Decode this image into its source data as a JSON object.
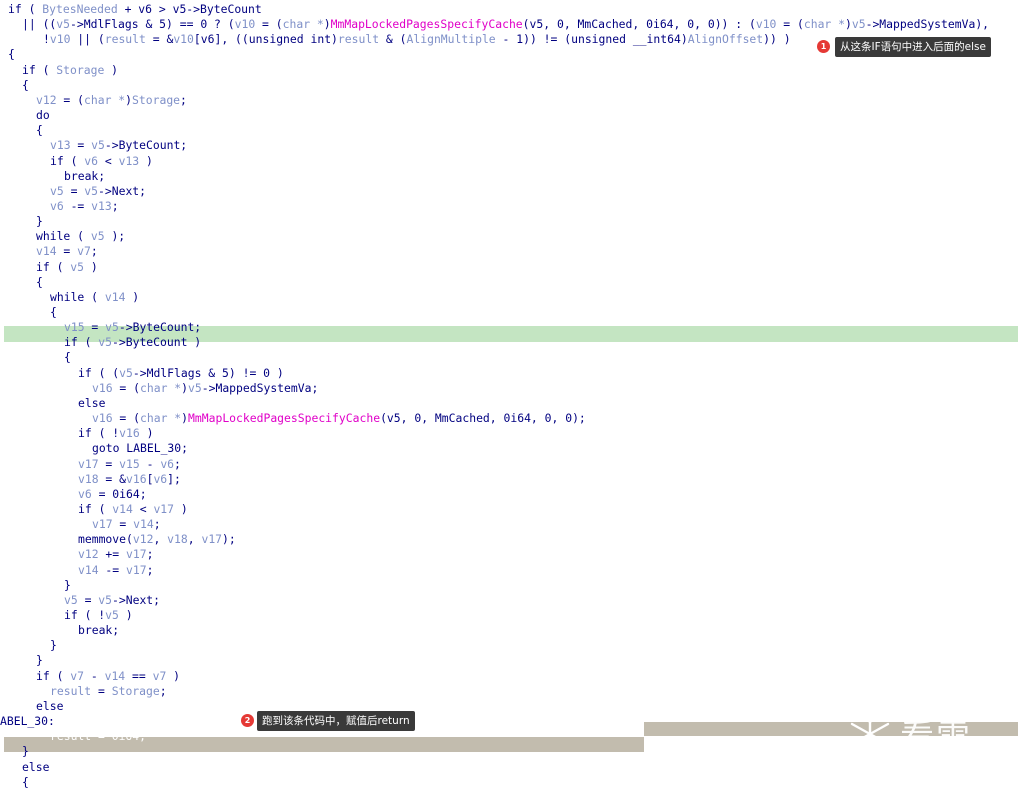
{
  "code_lines": [
    {
      "indent": 0,
      "parts": [
        [
          "kw",
          "if ( "
        ],
        [
          "var",
          "BytesNeeded"
        ],
        [
          "kw",
          " + v6 > v5->ByteCount"
        ]
      ]
    },
    {
      "indent": 2,
      "parts": [
        [
          "kw",
          "|| (("
        ],
        [
          "var",
          "v5"
        ],
        [
          "kw",
          "->MdlFlags & 5) == 0 ? ("
        ],
        [
          "var",
          "v10"
        ],
        [
          "kw",
          " = ("
        ],
        [
          "var",
          "char *"
        ],
        [
          "kw",
          ")"
        ],
        [
          "fn",
          "MmMapLockedPagesSpecifyCache"
        ],
        [
          "kw",
          "(v5, 0, MmCached, 0i64, 0, 0)) : ("
        ],
        [
          "var",
          "v10"
        ],
        [
          "kw",
          " = ("
        ],
        [
          "var",
          "char *"
        ],
        [
          "kw",
          ")"
        ],
        [
          "var",
          "v5"
        ],
        [
          "kw",
          "->MappedSystemVa),"
        ]
      ]
    },
    {
      "indent": 5,
      "parts": [
        [
          "kw",
          "!"
        ],
        [
          "var",
          "v10"
        ],
        [
          "kw",
          " || ("
        ],
        [
          "var",
          "result"
        ],
        [
          "kw",
          " = &"
        ],
        [
          "var",
          "v10"
        ],
        [
          "kw",
          "[v6], ((unsigned int)"
        ],
        [
          "var",
          "result"
        ],
        [
          "kw",
          " & ("
        ],
        [
          "var",
          "AlignMultiple"
        ],
        [
          "kw",
          " - 1)) != (unsigned __int64)"
        ],
        [
          "var",
          "AlignOffset"
        ],
        [
          "kw",
          ")) )"
        ]
      ]
    },
    {
      "indent": 0,
      "parts": [
        [
          "kw",
          "{"
        ]
      ]
    },
    {
      "indent": 2,
      "parts": [
        [
          "kw",
          "if ( "
        ],
        [
          "var",
          "Storage"
        ],
        [
          "kw",
          " )"
        ]
      ]
    },
    {
      "indent": 2,
      "parts": [
        [
          "kw",
          "{"
        ]
      ]
    },
    {
      "indent": 4,
      "parts": [
        [
          "var",
          "v12"
        ],
        [
          "kw",
          " = ("
        ],
        [
          "var",
          "char *"
        ],
        [
          "kw",
          ")"
        ],
        [
          "var",
          "Storage"
        ],
        [
          "kw",
          ";"
        ]
      ]
    },
    {
      "indent": 4,
      "parts": [
        [
          "kw",
          "do"
        ]
      ]
    },
    {
      "indent": 4,
      "parts": [
        [
          "kw",
          "{"
        ]
      ]
    },
    {
      "indent": 6,
      "parts": [
        [
          "var",
          "v13"
        ],
        [
          "kw",
          " = "
        ],
        [
          "var",
          "v5"
        ],
        [
          "kw",
          "->ByteCount;"
        ]
      ]
    },
    {
      "indent": 6,
      "parts": [
        [
          "kw",
          "if ( "
        ],
        [
          "var",
          "v6"
        ],
        [
          "kw",
          " < "
        ],
        [
          "var",
          "v13"
        ],
        [
          "kw",
          " )"
        ]
      ]
    },
    {
      "indent": 8,
      "parts": [
        [
          "kw",
          "break;"
        ]
      ]
    },
    {
      "indent": 6,
      "parts": [
        [
          "var",
          "v5"
        ],
        [
          "kw",
          " = "
        ],
        [
          "var",
          "v5"
        ],
        [
          "kw",
          "->Next;"
        ]
      ]
    },
    {
      "indent": 6,
      "parts": [
        [
          "var",
          "v6"
        ],
        [
          "kw",
          " -= "
        ],
        [
          "var",
          "v13"
        ],
        [
          "kw",
          ";"
        ]
      ]
    },
    {
      "indent": 4,
      "parts": [
        [
          "kw",
          "}"
        ]
      ]
    },
    {
      "indent": 4,
      "parts": [
        [
          "kw",
          "while ( "
        ],
        [
          "var",
          "v5"
        ],
        [
          "kw",
          " );"
        ]
      ]
    },
    {
      "indent": 4,
      "parts": [
        [
          "var",
          "v14"
        ],
        [
          "kw",
          " = "
        ],
        [
          "var",
          "v7"
        ],
        [
          "kw",
          ";"
        ]
      ]
    },
    {
      "indent": 4,
      "parts": [
        [
          "kw",
          "if ( "
        ],
        [
          "var",
          "v5"
        ],
        [
          "kw",
          " )"
        ]
      ]
    },
    {
      "indent": 4,
      "parts": [
        [
          "kw",
          "{"
        ]
      ]
    },
    {
      "indent": 6,
      "parts": [
        [
          "kw",
          "while ( "
        ],
        [
          "var",
          "v14"
        ],
        [
          "kw",
          " )"
        ]
      ]
    },
    {
      "indent": 6,
      "parts": [
        [
          "kw",
          "{"
        ]
      ]
    },
    {
      "indent": 8,
      "parts": [
        [
          "var",
          "v15"
        ],
        [
          "kw",
          " = "
        ],
        [
          "var",
          "v5"
        ],
        [
          "kw",
          "->ByteCount;"
        ]
      ]
    },
    {
      "indent": 8,
      "parts": [
        [
          "kw",
          "if ( "
        ],
        [
          "var",
          "v5"
        ],
        [
          "kw",
          "->ByteCount )"
        ]
      ]
    },
    {
      "indent": 8,
      "parts": [
        [
          "kw",
          "{"
        ]
      ]
    },
    {
      "indent": 10,
      "parts": [
        [
          "kw",
          "if ( ("
        ],
        [
          "var",
          "v5"
        ],
        [
          "kw",
          "->MdlFlags & 5) != 0 )"
        ]
      ]
    },
    {
      "indent": 12,
      "parts": [
        [
          "var",
          "v16"
        ],
        [
          "kw",
          " = ("
        ],
        [
          "var",
          "char *"
        ],
        [
          "kw",
          ")"
        ],
        [
          "var",
          "v5"
        ],
        [
          "kw",
          "->MappedSystemVa;"
        ]
      ]
    },
    {
      "indent": 10,
      "parts": [
        [
          "kw",
          "else"
        ]
      ]
    },
    {
      "indent": 12,
      "parts": [
        [
          "var",
          "v16"
        ],
        [
          "kw",
          " = ("
        ],
        [
          "var",
          "char *"
        ],
        [
          "kw",
          ")"
        ],
        [
          "fn",
          "MmMapLockedPagesSpecifyCache"
        ],
        [
          "kw",
          "(v5, 0, MmCached, 0i64, 0, 0);"
        ]
      ]
    },
    {
      "indent": 10,
      "parts": [
        [
          "kw",
          "if ( !"
        ],
        [
          "var",
          "v16"
        ],
        [
          "kw",
          " )"
        ]
      ]
    },
    {
      "indent": 12,
      "parts": [
        [
          "kw",
          "goto LABEL_30;"
        ]
      ]
    },
    {
      "indent": 10,
      "parts": [
        [
          "var",
          "v17"
        ],
        [
          "kw",
          " = "
        ],
        [
          "var",
          "v15"
        ],
        [
          "kw",
          " - "
        ],
        [
          "var",
          "v6"
        ],
        [
          "kw",
          ";"
        ]
      ]
    },
    {
      "indent": 10,
      "parts": [
        [
          "var",
          "v18"
        ],
        [
          "kw",
          " = &"
        ],
        [
          "var",
          "v16"
        ],
        [
          "kw",
          "["
        ],
        [
          "var",
          "v6"
        ],
        [
          "kw",
          "];"
        ]
      ]
    },
    {
      "indent": 10,
      "parts": [
        [
          "var",
          "v6"
        ],
        [
          "kw",
          " = 0i64;"
        ]
      ]
    },
    {
      "indent": 10,
      "parts": [
        [
          "kw",
          "if ( "
        ],
        [
          "var",
          "v14"
        ],
        [
          "kw",
          " < "
        ],
        [
          "var",
          "v17"
        ],
        [
          "kw",
          " )"
        ]
      ]
    },
    {
      "indent": 12,
      "parts": [
        [
          "var",
          "v17"
        ],
        [
          "kw",
          " = "
        ],
        [
          "var",
          "v14"
        ],
        [
          "kw",
          ";"
        ]
      ]
    },
    {
      "indent": 10,
      "parts": [
        [
          "kw",
          "memmove("
        ],
        [
          "var",
          "v12"
        ],
        [
          "kw",
          ", "
        ],
        [
          "var",
          "v18"
        ],
        [
          "kw",
          ", "
        ],
        [
          "var",
          "v17"
        ],
        [
          "kw",
          ");"
        ]
      ]
    },
    {
      "indent": 10,
      "parts": [
        [
          "var",
          "v12"
        ],
        [
          "kw",
          " += "
        ],
        [
          "var",
          "v17"
        ],
        [
          "kw",
          ";"
        ]
      ]
    },
    {
      "indent": 10,
      "parts": [
        [
          "var",
          "v14"
        ],
        [
          "kw",
          " -= "
        ],
        [
          "var",
          "v17"
        ],
        [
          "kw",
          ";"
        ]
      ]
    },
    {
      "indent": 8,
      "parts": [
        [
          "kw",
          "}"
        ]
      ]
    },
    {
      "indent": 8,
      "parts": [
        [
          "var",
          "v5"
        ],
        [
          "kw",
          " = "
        ],
        [
          "var",
          "v5"
        ],
        [
          "kw",
          "->Next;"
        ]
      ]
    },
    {
      "indent": 8,
      "parts": [
        [
          "kw",
          "if ( !"
        ],
        [
          "var",
          "v5"
        ],
        [
          "kw",
          " )"
        ]
      ]
    },
    {
      "indent": 10,
      "parts": [
        [
          "kw",
          "break;"
        ]
      ]
    },
    {
      "indent": 6,
      "parts": [
        [
          "kw",
          "}"
        ]
      ]
    },
    {
      "indent": 4,
      "parts": [
        [
          "kw",
          "}"
        ]
      ]
    },
    {
      "indent": 4,
      "parts": [
        [
          "kw",
          "if ( "
        ],
        [
          "var",
          "v7"
        ],
        [
          "kw",
          " - "
        ],
        [
          "var",
          "v14"
        ],
        [
          "kw",
          " == "
        ],
        [
          "var",
          "v7"
        ],
        [
          "kw",
          " )"
        ]
      ]
    },
    {
      "indent": 6,
      "parts": [
        [
          "var",
          "result"
        ],
        [
          "kw",
          " = "
        ],
        [
          "var",
          "Storage"
        ],
        [
          "kw",
          ";"
        ]
      ]
    },
    {
      "indent": 4,
      "parts": [
        [
          "kw",
          "else"
        ]
      ]
    },
    {
      "indent": 0,
      "parts": [
        [
          "kw",
          "ABEL_30:"
        ]
      ]
    },
    {
      "indent": 6,
      "parts": [
        [
          "light",
          "result = 0i64;"
        ]
      ]
    },
    {
      "indent": 2,
      "parts": [
        [
          "kw",
          "}"
        ]
      ]
    },
    {
      "indent": 2,
      "parts": [
        [
          "kw",
          "else"
        ]
      ]
    },
    {
      "indent": 2,
      "parts": [
        [
          "kw",
          "{"
        ]
      ]
    }
  ],
  "annotations": {
    "callout1": {
      "badge": "1",
      "text": "从这条IF语句中进入后面的else"
    },
    "callout2": {
      "badge": "2",
      "text": "跑到该条代码中，赋值后return"
    }
  },
  "watermark": {
    "text": "看雪"
  },
  "colors": {
    "keyword": "#000080",
    "variable": "#7f90c8",
    "function": "#e000c8",
    "highlight_green": "#c4e5c2",
    "highlight_gray": "#c2bcae",
    "badge": "#e53935"
  }
}
